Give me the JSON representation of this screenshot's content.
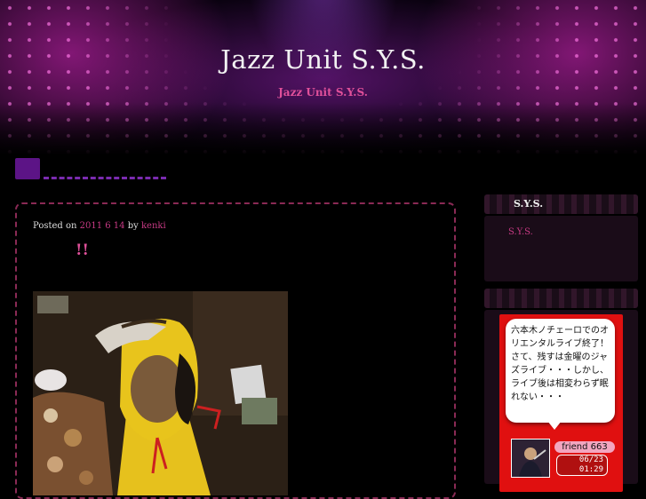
{
  "site": {
    "title": "Jazz Unit S.Y.S.",
    "description": "Jazz Unit S.Y.S."
  },
  "post": {
    "posted_on_label": "Posted on",
    "date": "2011 6 14",
    "by_label": "by",
    "author": "kenki",
    "title": "!!"
  },
  "sidebar": {
    "widget1": {
      "title": "S.Y.S.",
      "link": "S.Y.S."
    },
    "friend_widget": {
      "message": "六本木ノチェーロでのオリエンタルライブ終了！さて、残すは金曜のジャズライブ・・・しかし、ライブ後は相変わらず眠れない・・・",
      "friend_label": "friend 663",
      "date": "06/23",
      "time": "01:29"
    }
  },
  "colors": {
    "accent": "#e0509a",
    "link": "#c73a84",
    "nav": "#5c1486",
    "post_border": "#8a2a55",
    "widget_bg": "#e01010"
  }
}
